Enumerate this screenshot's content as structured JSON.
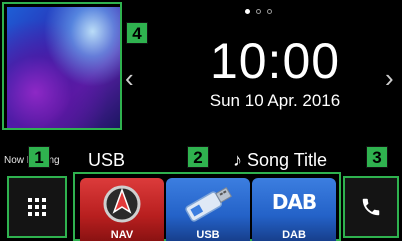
{
  "callouts": [
    "1",
    "2",
    "3",
    "4"
  ],
  "clock": {
    "time": "10:00",
    "date": "Sun 10 Apr. 2016"
  },
  "pager": {
    "count": 3,
    "active_index": 0
  },
  "status": {
    "now_playing": "Now Playing",
    "source": "USB",
    "song": "♪ Song Title"
  },
  "shortcuts": [
    {
      "label": "NAV",
      "icon": "nav-icon"
    },
    {
      "label": "USB",
      "icon": "usb-icon"
    },
    {
      "label": "DAB",
      "icon": "dab-icon",
      "logo_text": "DAB"
    }
  ],
  "buttons": {
    "menu_icon": "grid-menu-icon",
    "phone_icon": "phone-icon"
  },
  "arrows": {
    "prev": "‹",
    "next": "›"
  },
  "colors": {
    "callout": "#2fb24f",
    "background": "#000000",
    "text": "#ffffff"
  }
}
